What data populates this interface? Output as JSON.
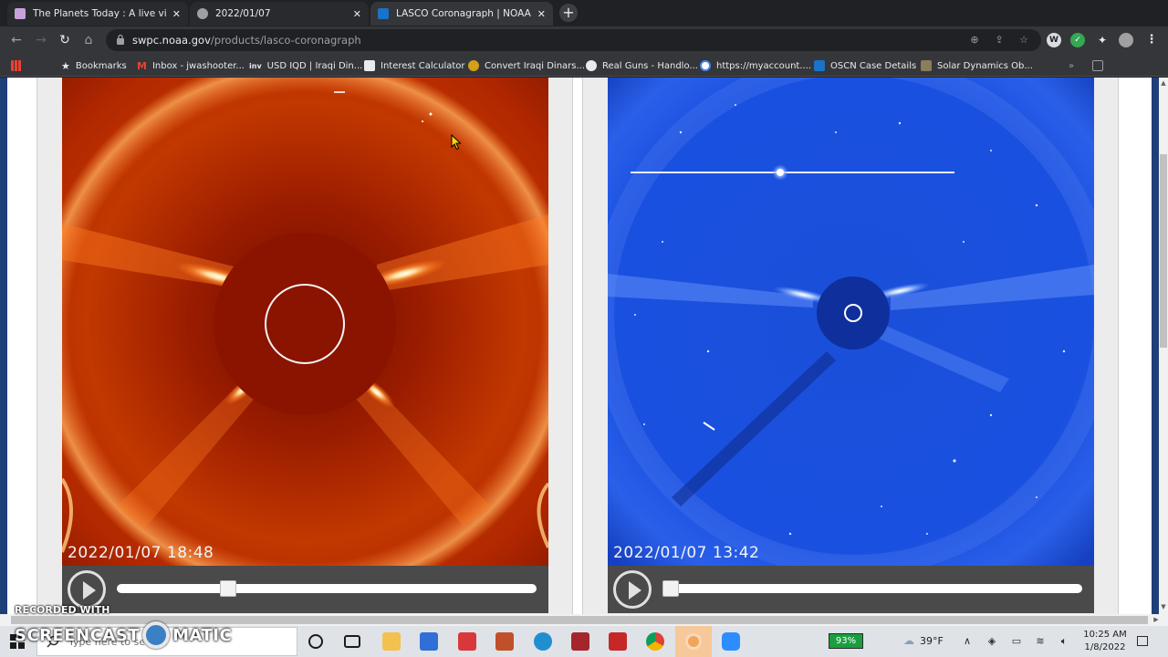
{
  "tabs": [
    {
      "label": "The Planets Today : A live view of",
      "active": false
    },
    {
      "label": "2022/01/07",
      "active": false
    },
    {
      "label": "LASCO Coronagraph | NOAA / NWS",
      "active": true
    }
  ],
  "toolbar": {
    "url_domain": "swpc.noaa.gov",
    "url_path": "/products/lasco-coronagraph"
  },
  "bookmarks": [
    {
      "label": "Apps"
    },
    {
      "label": "Bookmarks"
    },
    {
      "label": "Inbox - jwashooter..."
    },
    {
      "label": "USD IQD | Iraqi Din..."
    },
    {
      "label": "Interest Calculator"
    },
    {
      "label": "Convert Iraqi Dinars..."
    },
    {
      "label": "Real Guns - Handlo..."
    },
    {
      "label": "https://myaccount...."
    },
    {
      "label": "OSCN Case Details"
    },
    {
      "label": "Solar Dynamics Ob..."
    },
    {
      "label": "Other bookmarks"
    }
  ],
  "panels": [
    {
      "timestamp": "2022/01/07  18:48",
      "progress": 0.255
    },
    {
      "timestamp": "2022/01/07  13:42",
      "progress": 0.0
    }
  ],
  "watermark": {
    "line1": "RECORDED WITH",
    "left": "SCREENCAST",
    "right": "MATIC"
  },
  "taskbar": {
    "search_placeholder": "Type here to search",
    "battery": "93%",
    "temperature": "39°F",
    "time": "10:25 AM",
    "date": "1/8/2022"
  },
  "colors": {
    "c2_background": "#b32a00",
    "c3_background": "#1749d8",
    "omnibox": "#202124",
    "tab_active": "#35363a"
  }
}
